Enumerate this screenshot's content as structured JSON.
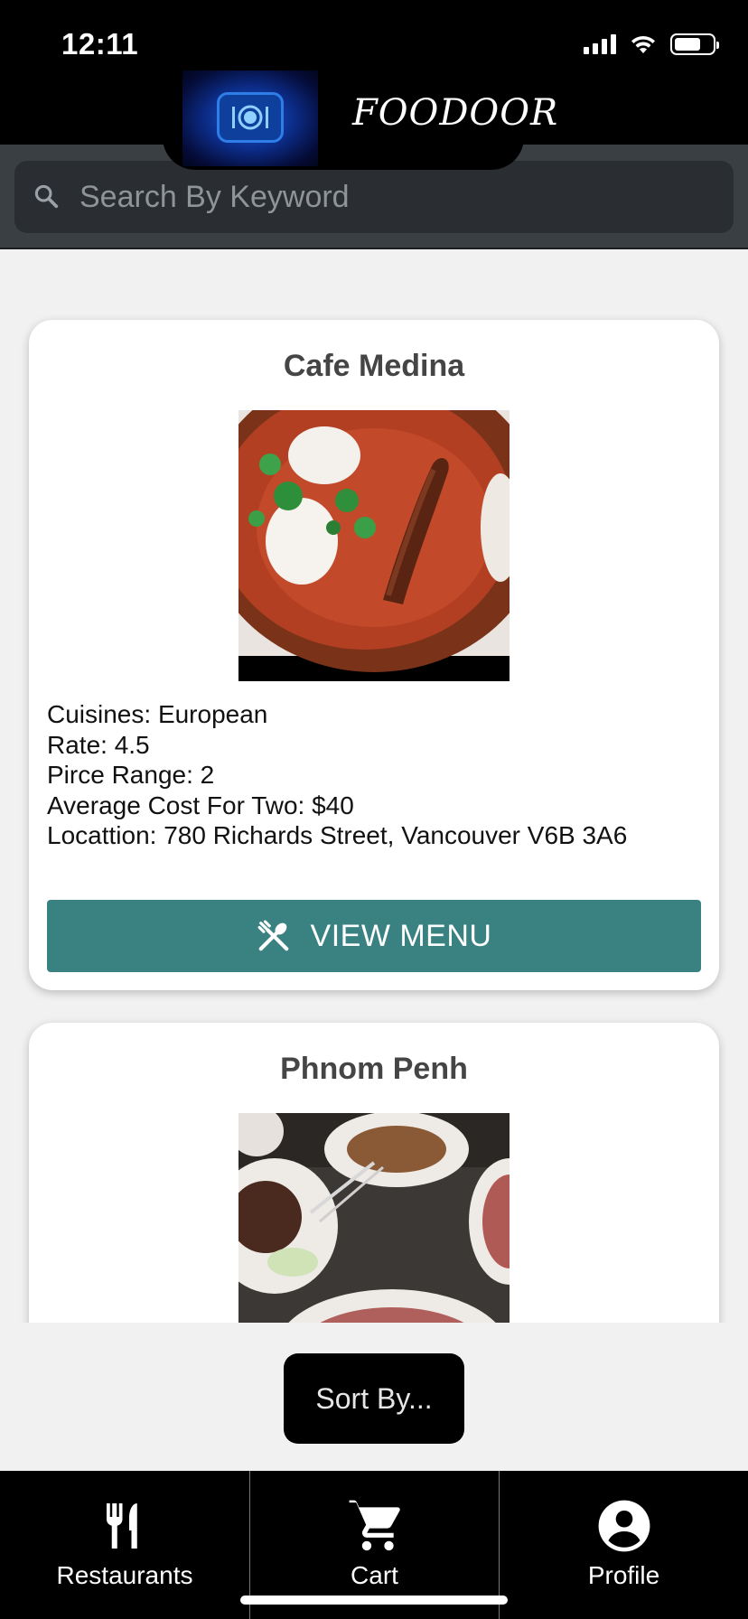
{
  "status_bar": {
    "time": "12:11"
  },
  "header": {
    "brand": "FOODOOR",
    "logo_icon": "plate-cutlery-icon"
  },
  "search": {
    "placeholder": "Search By Keyword",
    "icon": "search-icon"
  },
  "restaurants": [
    {
      "name": "Cafe Medina",
      "cuisines_line": "Cuisines: European",
      "rate_line": "Rate: 4.5",
      "price_line": "Pirce Range: 2",
      "avg_cost_line": "Average Cost For Two: $40",
      "location_line": "Locattion: 780 Richards Street, Vancouver V6B 3A6",
      "button_label": "VIEW MENU"
    },
    {
      "name": "Phnom Penh"
    }
  ],
  "sort_button": "Sort By...",
  "tabs": [
    {
      "label": "Restaurants",
      "icon": "restaurant-cutlery-icon"
    },
    {
      "label": "Cart",
      "icon": "cart-icon"
    },
    {
      "label": "Profile",
      "icon": "profile-icon"
    }
  ],
  "colors": {
    "accent": "#3a8282",
    "header_bg": "#000000",
    "search_band": "#3a3f44"
  }
}
